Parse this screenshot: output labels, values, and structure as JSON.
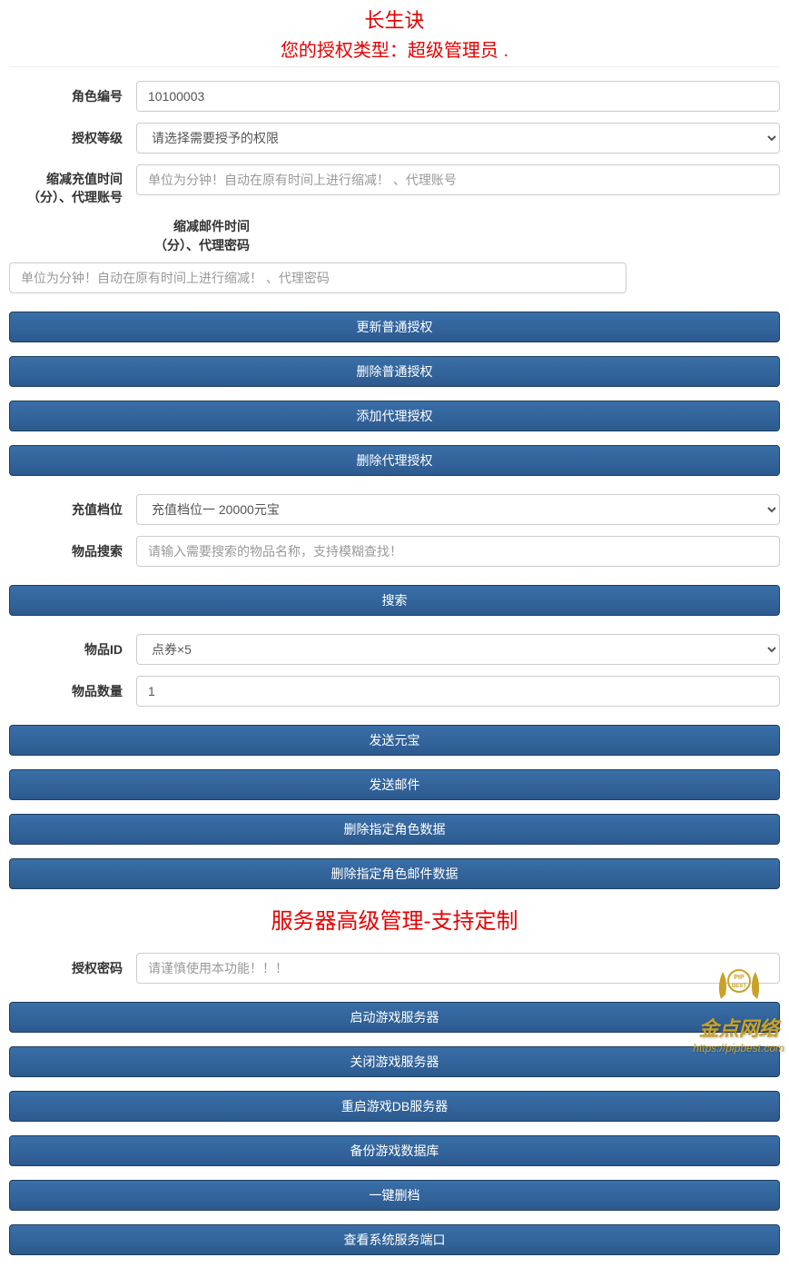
{
  "header": {
    "title": "长生诀",
    "subtitle": "您的授权类型：超级管理员 ."
  },
  "form1": {
    "role_id_label": "角色编号",
    "role_id_value": "10100003",
    "auth_level_label": "授权等级",
    "auth_level_selected": "请选择需要授予的权限",
    "reduce_recharge_label": "缩减充值时间（分）、代理账号",
    "reduce_recharge_placeholder": "单位为分钟！自动在原有时间上进行缩减！ 、代理账号",
    "reduce_mail_label": "缩减邮件时间（分）、代理密码",
    "reduce_mail_placeholder": "单位为分钟！自动在原有时间上进行缩减！ 、代理密码"
  },
  "buttons1": {
    "update_normal": "更新普通授权",
    "delete_normal": "删除普通授权",
    "add_agent": "添加代理授权",
    "delete_agent": "删除代理授权"
  },
  "form2": {
    "recharge_tier_label": "充值档位",
    "recharge_tier_selected": "充值档位一 20000元宝",
    "item_search_label": "物品搜索",
    "item_search_placeholder": "请输入需要搜索的物品名称，支持模糊查找！"
  },
  "buttons2": {
    "search": "搜索"
  },
  "form3": {
    "item_id_label": "物品ID",
    "item_id_selected": "点券×5",
    "item_qty_label": "物品数量",
    "item_qty_value": "1"
  },
  "buttons3": {
    "send_yuanbao": "发送元宝",
    "send_mail": "发送邮件",
    "delete_role_data": "删除指定角色数据",
    "delete_role_mail": "删除指定角色邮件数据"
  },
  "section2": {
    "title": "服务器高级管理-支持定制",
    "auth_password_label": "授权密码",
    "auth_password_placeholder": "请谨慎使用本功能！！！"
  },
  "buttons4": {
    "start_server": "启动游戏服务器",
    "stop_server": "关闭游戏服务器",
    "restart_db": "重启游戏DB服务器",
    "backup_db": "备份游戏数据库",
    "wipe": "一键删档",
    "view_ports": "查看系统服务端口"
  },
  "watermark": {
    "text": "金点网络",
    "url": "https://pipbest.com"
  }
}
